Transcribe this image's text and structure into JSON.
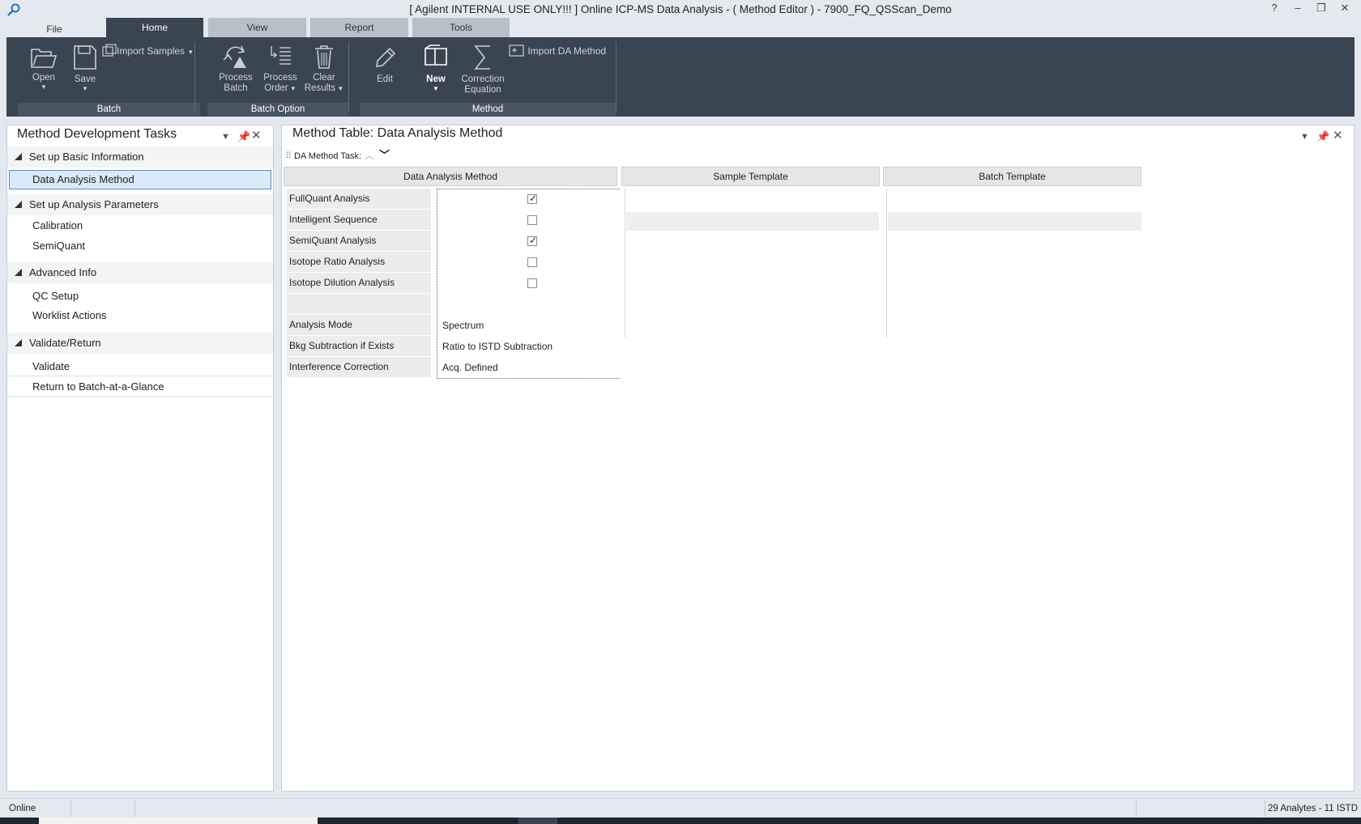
{
  "window": {
    "title": "[ Agilent INTERNAL USE ONLY!!! ] Online ICP-MS Data Analysis - ( Method Editor ) - 7900_FQ_QSScan_Demo",
    "controls": [
      "?",
      "–",
      "❐",
      "✕"
    ]
  },
  "tabs": {
    "file": "File",
    "home": "Home",
    "view": "View",
    "report": "Report",
    "tools": "Tools",
    "active": "Home"
  },
  "ribbon": {
    "open": "Open",
    "save": "Save",
    "import_samples": "Import Samples",
    "process_batch_1": "Process",
    "process_batch_2": "Batch",
    "process_order_1": "Process",
    "process_order_2": "Order",
    "clear_results_1": "Clear",
    "clear_results_2": "Results",
    "edit": "Edit",
    "new": "New",
    "correction_1": "Correction",
    "correction_2": "Equation",
    "import_da_method": "Import DA Method",
    "groups": {
      "batch": "Batch",
      "batch_option": "Batch Option",
      "method": "Method"
    }
  },
  "left_panel": {
    "title": "Method Development Tasks",
    "sections": [
      {
        "label": "Set up Basic Information",
        "items": [
          "Data Analysis Method"
        ]
      },
      {
        "label": "Set up Analysis Parameters",
        "items": [
          "Calibration",
          "SemiQuant"
        ]
      },
      {
        "label": "Advanced Info",
        "items": [
          "QC Setup",
          "Worklist Actions"
        ]
      },
      {
        "label": "Validate/Return",
        "items": [
          "Validate",
          "Return to Batch-at-a-Glance"
        ]
      }
    ],
    "selected_item": "Data Analysis Method"
  },
  "right_panel": {
    "title": "Method Table: Data Analysis Method",
    "da_method_task_label": "DA Method Task:",
    "columns": [
      "Data Analysis Method",
      "Sample Template",
      "Batch Template"
    ],
    "checkbox_rows": [
      {
        "label": "FullQuant Analysis",
        "checked": true
      },
      {
        "label": "Intelligent Sequence",
        "checked": false
      },
      {
        "label": "SemiQuant Analysis",
        "checked": true
      },
      {
        "label": "Isotope Ratio Analysis",
        "checked": false
      },
      {
        "label": "Isotope Dilution Analysis",
        "checked": false
      }
    ],
    "value_rows": [
      {
        "label": "Analysis Mode",
        "value": "Spectrum"
      },
      {
        "label": "Bkg Subtraction if Exists",
        "value": "Ratio to ISTD Subtraction"
      },
      {
        "label": "Interference Correction",
        "value": "Acq. Defined"
      }
    ]
  },
  "status_bar": {
    "left": "Online",
    "right": "29 Analytes - 11 ISTD"
  }
}
